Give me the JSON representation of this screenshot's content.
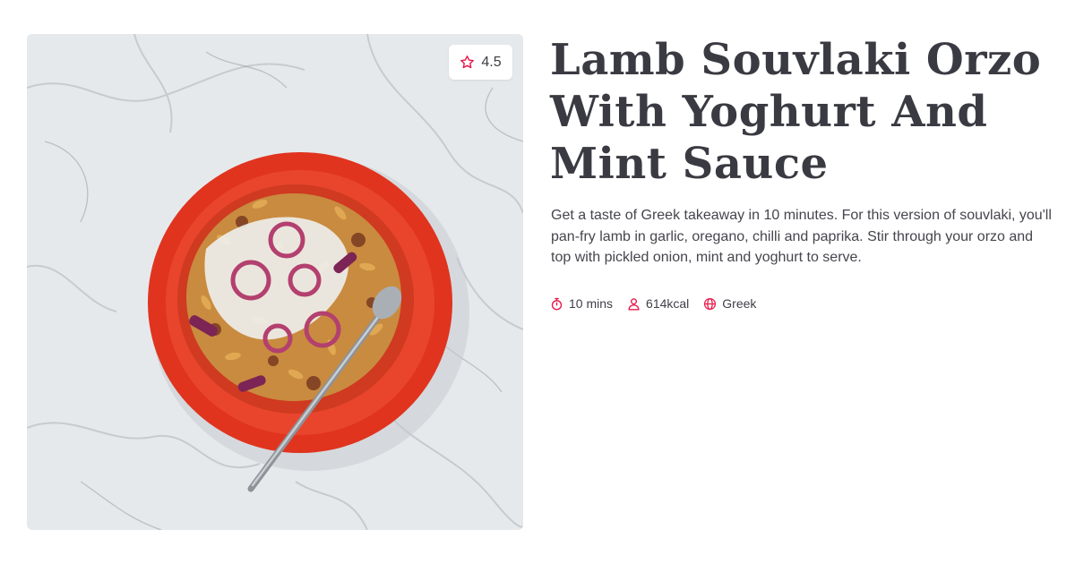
{
  "recipe": {
    "title": "Lamb Souvlaki Orzo With Yoghurt And Mint Sauce",
    "description": "Get a taste of Greek takeaway in 10 minutes. For this version of souvlaki, you'll pan-fry lamb in garlic, oregano, chilli and paprika. Stir through your orzo and top with pickled onion, mint and yoghurt to serve.",
    "rating": "4.5",
    "rating_icon": "star-outline-icon",
    "meta": {
      "time": "10 mins",
      "time_icon": "stopwatch-icon",
      "calories": "614kcal",
      "calories_icon": "person-icon",
      "cuisine": "Greek",
      "cuisine_icon": "globe-icon"
    },
    "image": {
      "subject": "red bowl of lamb orzo with pickled red onion, yoghurt and a spoon on white marble"
    }
  },
  "colors": {
    "accent": "#e8174a",
    "title": "#3a3a42",
    "body_text": "#45454d",
    "bowl": "#e0341f"
  }
}
